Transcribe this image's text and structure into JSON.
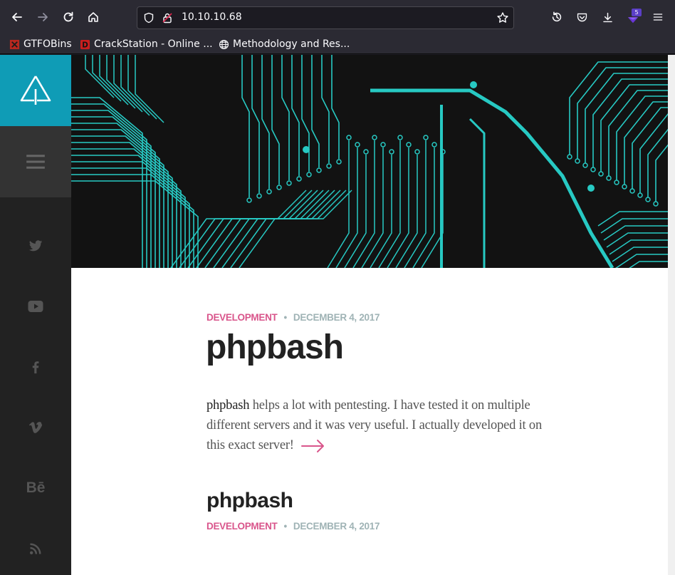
{
  "browser": {
    "url": "10.10.10.68",
    "bookmarks": [
      {
        "label": "GTFOBins",
        "icon": "gtfobins-icon"
      },
      {
        "label": "CrackStation - Online ...",
        "icon": "crackstation-icon"
      },
      {
        "label": "Methodology and Res...",
        "icon": "globe-icon"
      }
    ],
    "extension_badge": "5"
  },
  "site": {
    "accent_color": "#0f9cb6",
    "sidebar_color": "#222222",
    "social": [
      {
        "name": "twitter-icon"
      },
      {
        "name": "youtube-icon"
      },
      {
        "name": "facebook-icon"
      },
      {
        "name": "vimeo-icon"
      },
      {
        "name": "behance-icon",
        "text": "Bē"
      },
      {
        "name": "rss-icon"
      }
    ]
  },
  "posts": [
    {
      "category": "DEVELOPMENT",
      "separator": "•",
      "date": "DECEMBER 4, 2017",
      "title": "phpbash",
      "excerpt_lead": "phpbash",
      "excerpt_rest": " helps a lot with pentesting. I have tested it on multiple different servers and it was very useful. I actually developed it on this exact server!"
    },
    {
      "category": "DEVELOPMENT",
      "separator": "•",
      "date": "DECEMBER 4, 2017",
      "title": "phpbash"
    }
  ]
}
